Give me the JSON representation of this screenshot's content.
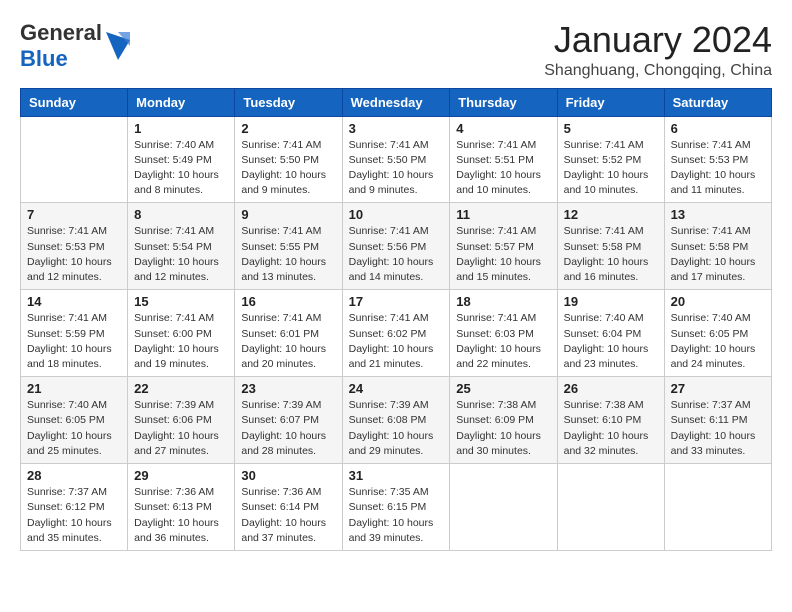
{
  "header": {
    "logo_general": "General",
    "logo_blue": "Blue",
    "month_title": "January 2024",
    "location": "Shanghuang, Chongqing, China"
  },
  "weekdays": [
    "Sunday",
    "Monday",
    "Tuesday",
    "Wednesday",
    "Thursday",
    "Friday",
    "Saturday"
  ],
  "weeks": [
    [
      {
        "day": "",
        "sunrise": "",
        "sunset": "",
        "daylight": ""
      },
      {
        "day": "1",
        "sunrise": "Sunrise: 7:40 AM",
        "sunset": "Sunset: 5:49 PM",
        "daylight": "Daylight: 10 hours and 8 minutes."
      },
      {
        "day": "2",
        "sunrise": "Sunrise: 7:41 AM",
        "sunset": "Sunset: 5:50 PM",
        "daylight": "Daylight: 10 hours and 9 minutes."
      },
      {
        "day": "3",
        "sunrise": "Sunrise: 7:41 AM",
        "sunset": "Sunset: 5:50 PM",
        "daylight": "Daylight: 10 hours and 9 minutes."
      },
      {
        "day": "4",
        "sunrise": "Sunrise: 7:41 AM",
        "sunset": "Sunset: 5:51 PM",
        "daylight": "Daylight: 10 hours and 10 minutes."
      },
      {
        "day": "5",
        "sunrise": "Sunrise: 7:41 AM",
        "sunset": "Sunset: 5:52 PM",
        "daylight": "Daylight: 10 hours and 10 minutes."
      },
      {
        "day": "6",
        "sunrise": "Sunrise: 7:41 AM",
        "sunset": "Sunset: 5:53 PM",
        "daylight": "Daylight: 10 hours and 11 minutes."
      }
    ],
    [
      {
        "day": "7",
        "sunrise": "Sunrise: 7:41 AM",
        "sunset": "Sunset: 5:53 PM",
        "daylight": "Daylight: 10 hours and 12 minutes."
      },
      {
        "day": "8",
        "sunrise": "Sunrise: 7:41 AM",
        "sunset": "Sunset: 5:54 PM",
        "daylight": "Daylight: 10 hours and 12 minutes."
      },
      {
        "day": "9",
        "sunrise": "Sunrise: 7:41 AM",
        "sunset": "Sunset: 5:55 PM",
        "daylight": "Daylight: 10 hours and 13 minutes."
      },
      {
        "day": "10",
        "sunrise": "Sunrise: 7:41 AM",
        "sunset": "Sunset: 5:56 PM",
        "daylight": "Daylight: 10 hours and 14 minutes."
      },
      {
        "day": "11",
        "sunrise": "Sunrise: 7:41 AM",
        "sunset": "Sunset: 5:57 PM",
        "daylight": "Daylight: 10 hours and 15 minutes."
      },
      {
        "day": "12",
        "sunrise": "Sunrise: 7:41 AM",
        "sunset": "Sunset: 5:58 PM",
        "daylight": "Daylight: 10 hours and 16 minutes."
      },
      {
        "day": "13",
        "sunrise": "Sunrise: 7:41 AM",
        "sunset": "Sunset: 5:58 PM",
        "daylight": "Daylight: 10 hours and 17 minutes."
      }
    ],
    [
      {
        "day": "14",
        "sunrise": "Sunrise: 7:41 AM",
        "sunset": "Sunset: 5:59 PM",
        "daylight": "Daylight: 10 hours and 18 minutes."
      },
      {
        "day": "15",
        "sunrise": "Sunrise: 7:41 AM",
        "sunset": "Sunset: 6:00 PM",
        "daylight": "Daylight: 10 hours and 19 minutes."
      },
      {
        "day": "16",
        "sunrise": "Sunrise: 7:41 AM",
        "sunset": "Sunset: 6:01 PM",
        "daylight": "Daylight: 10 hours and 20 minutes."
      },
      {
        "day": "17",
        "sunrise": "Sunrise: 7:41 AM",
        "sunset": "Sunset: 6:02 PM",
        "daylight": "Daylight: 10 hours and 21 minutes."
      },
      {
        "day": "18",
        "sunrise": "Sunrise: 7:41 AM",
        "sunset": "Sunset: 6:03 PM",
        "daylight": "Daylight: 10 hours and 22 minutes."
      },
      {
        "day": "19",
        "sunrise": "Sunrise: 7:40 AM",
        "sunset": "Sunset: 6:04 PM",
        "daylight": "Daylight: 10 hours and 23 minutes."
      },
      {
        "day": "20",
        "sunrise": "Sunrise: 7:40 AM",
        "sunset": "Sunset: 6:05 PM",
        "daylight": "Daylight: 10 hours and 24 minutes."
      }
    ],
    [
      {
        "day": "21",
        "sunrise": "Sunrise: 7:40 AM",
        "sunset": "Sunset: 6:05 PM",
        "daylight": "Daylight: 10 hours and 25 minutes."
      },
      {
        "day": "22",
        "sunrise": "Sunrise: 7:39 AM",
        "sunset": "Sunset: 6:06 PM",
        "daylight": "Daylight: 10 hours and 27 minutes."
      },
      {
        "day": "23",
        "sunrise": "Sunrise: 7:39 AM",
        "sunset": "Sunset: 6:07 PM",
        "daylight": "Daylight: 10 hours and 28 minutes."
      },
      {
        "day": "24",
        "sunrise": "Sunrise: 7:39 AM",
        "sunset": "Sunset: 6:08 PM",
        "daylight": "Daylight: 10 hours and 29 minutes."
      },
      {
        "day": "25",
        "sunrise": "Sunrise: 7:38 AM",
        "sunset": "Sunset: 6:09 PM",
        "daylight": "Daylight: 10 hours and 30 minutes."
      },
      {
        "day": "26",
        "sunrise": "Sunrise: 7:38 AM",
        "sunset": "Sunset: 6:10 PM",
        "daylight": "Daylight: 10 hours and 32 minutes."
      },
      {
        "day": "27",
        "sunrise": "Sunrise: 7:37 AM",
        "sunset": "Sunset: 6:11 PM",
        "daylight": "Daylight: 10 hours and 33 minutes."
      }
    ],
    [
      {
        "day": "28",
        "sunrise": "Sunrise: 7:37 AM",
        "sunset": "Sunset: 6:12 PM",
        "daylight": "Daylight: 10 hours and 35 minutes."
      },
      {
        "day": "29",
        "sunrise": "Sunrise: 7:36 AM",
        "sunset": "Sunset: 6:13 PM",
        "daylight": "Daylight: 10 hours and 36 minutes."
      },
      {
        "day": "30",
        "sunrise": "Sunrise: 7:36 AM",
        "sunset": "Sunset: 6:14 PM",
        "daylight": "Daylight: 10 hours and 37 minutes."
      },
      {
        "day": "31",
        "sunrise": "Sunrise: 7:35 AM",
        "sunset": "Sunset: 6:15 PM",
        "daylight": "Daylight: 10 hours and 39 minutes."
      },
      {
        "day": "",
        "sunrise": "",
        "sunset": "",
        "daylight": ""
      },
      {
        "day": "",
        "sunrise": "",
        "sunset": "",
        "daylight": ""
      },
      {
        "day": "",
        "sunrise": "",
        "sunset": "",
        "daylight": ""
      }
    ]
  ]
}
